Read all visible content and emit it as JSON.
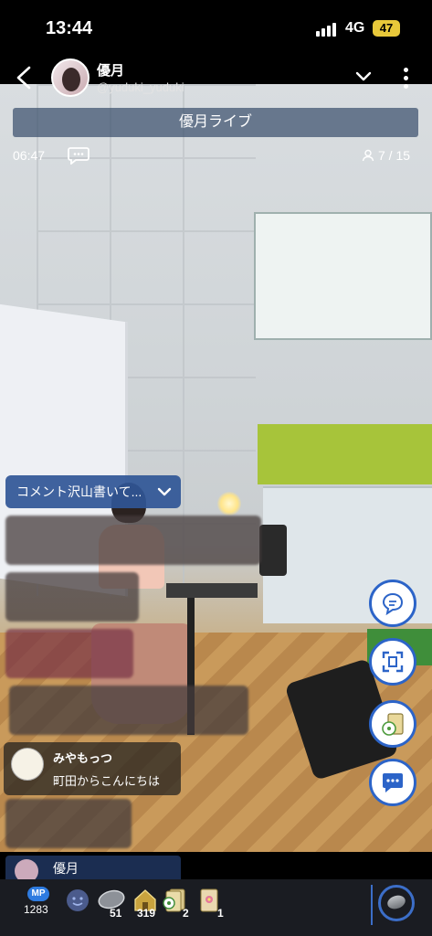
{
  "status_bar": {
    "time": "13:44",
    "network": "4G",
    "battery": "47"
  },
  "header": {
    "streamer_name": "優月",
    "streamer_handle": "@yuduki_yuduki"
  },
  "live": {
    "title": "優月ライブ",
    "elapsed": "06:47",
    "viewers": "7 / 15"
  },
  "pinned_comment": {
    "label": "コメント沢山書いて..."
  },
  "comments": [
    {
      "name": "みやもっつ",
      "text": "町田からこんにちは"
    }
  ],
  "bottom": {
    "streamer_name": "優月",
    "mp_label": "MP",
    "mp_value": "1283",
    "items": [
      {
        "icon": "smiley-icon",
        "count": ""
      },
      {
        "icon": "coin-icon",
        "count": "51"
      },
      {
        "icon": "house-gift-icon",
        "count": "319"
      },
      {
        "icon": "card-stack-icon",
        "count": "2"
      },
      {
        "icon": "flower-card-icon",
        "count": "1"
      }
    ]
  },
  "colors": {
    "accent_blue": "#2c64c8",
    "pinned_bg": "#305696",
    "battery": "#e8c83a"
  }
}
